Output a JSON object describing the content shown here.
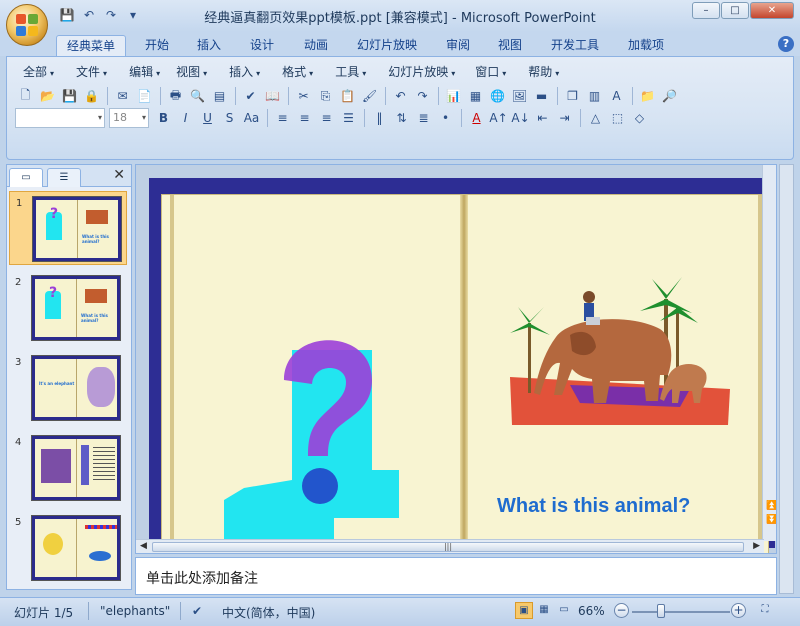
{
  "window": {
    "title": "经典逼真翻页效果ppt模板.ppt [兼容模式] - Microsoft PowerPoint",
    "controls": [
      "minimize",
      "maximize",
      "close"
    ]
  },
  "quick_access": [
    "save-icon",
    "undo-icon",
    "redo-icon",
    "customize-icon"
  ],
  "tabs": [
    {
      "label": "经典菜单",
      "active": true
    },
    {
      "label": "开始"
    },
    {
      "label": "插入"
    },
    {
      "label": "设计"
    },
    {
      "label": "动画"
    },
    {
      "label": "幻灯片放映"
    },
    {
      "label": "审阅"
    },
    {
      "label": "视图"
    },
    {
      "label": "开发工具"
    },
    {
      "label": "加载项"
    }
  ],
  "menu": [
    {
      "label": "全部"
    },
    {
      "label": "文件"
    },
    {
      "label": "编辑"
    },
    {
      "label": "视图"
    },
    {
      "label": "插入"
    },
    {
      "label": "格式"
    },
    {
      "label": "工具"
    },
    {
      "label": "幻灯片放映"
    },
    {
      "label": "窗口"
    },
    {
      "label": "帮助"
    }
  ],
  "format_bar": {
    "font_name": "",
    "font_size": "18"
  },
  "slide_panel": {
    "slides": [
      {
        "num": "1",
        "selected": true
      },
      {
        "num": "2"
      },
      {
        "num": "3"
      },
      {
        "num": "4"
      },
      {
        "num": "5"
      }
    ]
  },
  "slide": {
    "question_text": "What is this animal?",
    "colors": {
      "frame": "#2d2d94",
      "page": "#f8f4d2",
      "question": "#1f6ccf",
      "purple": "#9b3fd8",
      "cyan": "#22e5f0"
    }
  },
  "notes": {
    "placeholder": "单击此处添加备注"
  },
  "status": {
    "slide_info": "幻灯片 1/5",
    "theme": "\"elephants\"",
    "language": "中文(简体，中国)",
    "zoom": "66%"
  }
}
